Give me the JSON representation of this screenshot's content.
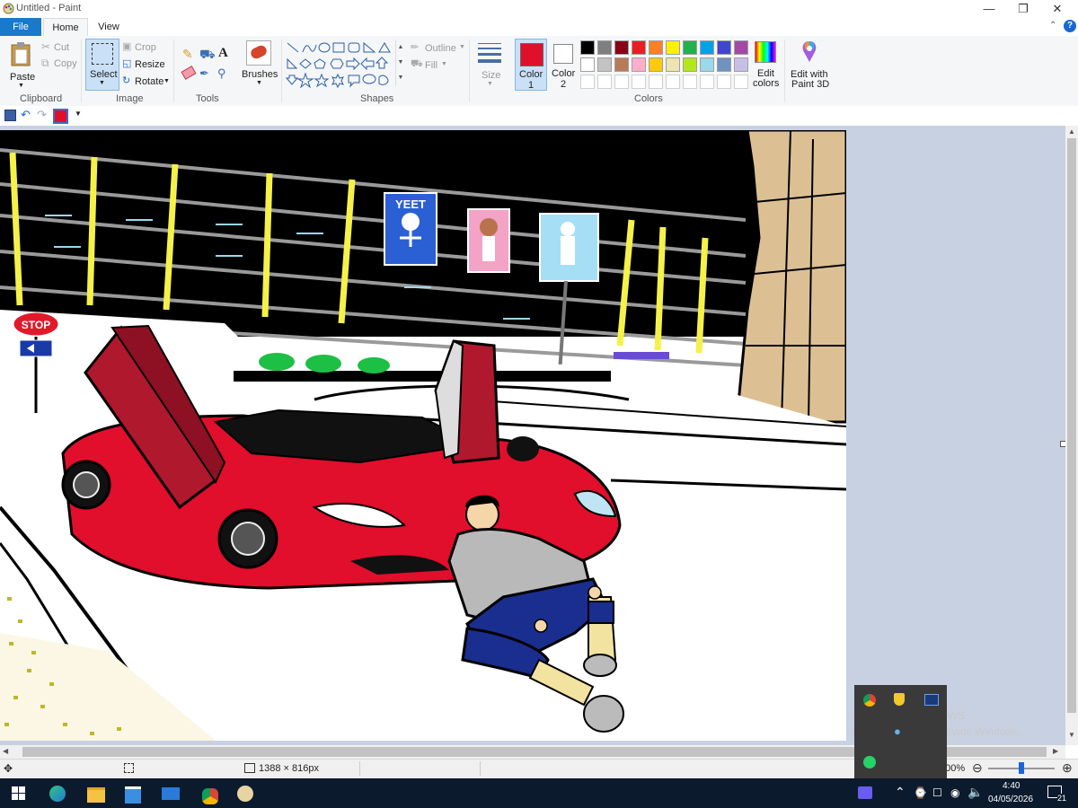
{
  "window": {
    "title": "Untitled - Paint"
  },
  "tabs": {
    "file": "File",
    "home": "Home",
    "view": "View"
  },
  "clipboard": {
    "paste": "Paste",
    "cut": "Cut",
    "copy": "Copy",
    "label": "Clipboard"
  },
  "image": {
    "select": "Select",
    "crop": "Crop",
    "resize": "Resize",
    "rotate": "Rotate",
    "label": "Image"
  },
  "tools": {
    "label": "Tools",
    "brushes": "Brushes"
  },
  "shapes": {
    "outline": "Outline",
    "fill": "Fill",
    "label": "Shapes"
  },
  "size": {
    "label": "Size"
  },
  "colors": {
    "color1_label": "Color",
    "color1_num": "1",
    "color2_label": "Color",
    "color2_num": "2",
    "label": "Colors",
    "edit_colors_line1": "Edit",
    "edit_colors_line2": "colors",
    "color1_value": "#e0102a",
    "color2_value": "#ffffff",
    "palette_row1": [
      "#000000",
      "#7f7f7f",
      "#880015",
      "#ed1c24",
      "#ff7f27",
      "#fff200",
      "#22b14c",
      "#00a2e8",
      "#3f48cc",
      "#a349a4"
    ],
    "palette_row2": [
      "#ffffff",
      "#c3c3c3",
      "#b97a57",
      "#ffaec9",
      "#ffc90e",
      "#efe4b0",
      "#b5e61d",
      "#99d9ea",
      "#7092be",
      "#c8bfe7"
    ]
  },
  "paint3d": {
    "line1": "Edit with",
    "line2": "Paint 3D"
  },
  "canvas": {
    "sign_stop": "STOP",
    "poster_yeet": "YEET"
  },
  "status": {
    "dimensions": "1388 × 816px",
    "zoom": "100%"
  },
  "overlay": {
    "activate_title": "Activate Windows",
    "activate_sub": "Go to Settings to activate Windows."
  },
  "taskbar": {
    "time": "4:40",
    "date": "04/05/2026",
    "notifications": "21"
  }
}
